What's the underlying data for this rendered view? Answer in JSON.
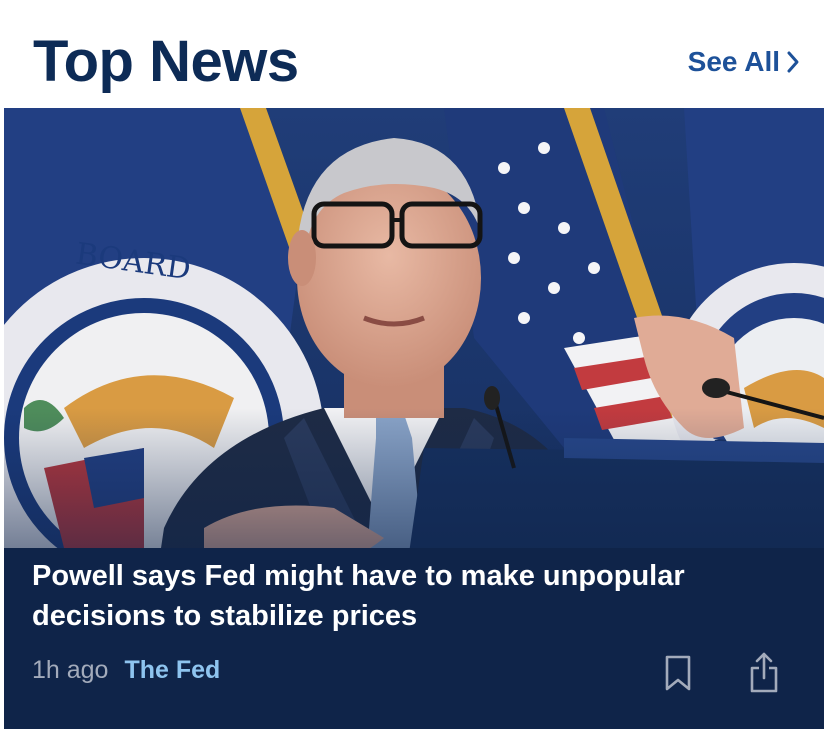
{
  "header": {
    "title": "Top News",
    "see_all_label": "See All",
    "see_all_icon": "chevron-right-icon"
  },
  "article": {
    "image_description": "Man in suit speaking at podium in front of flags",
    "headline": "Powell says Fed might have to make unpopular decisions to stabilize prices",
    "time": "1h ago",
    "tag": "The Fed",
    "actions": [
      {
        "icon": "bookmark-icon"
      },
      {
        "icon": "share-icon"
      }
    ]
  },
  "colors": {
    "title": "#0d2b56",
    "link": "#1d5199",
    "card_bg": "#0f2449",
    "tag": "#8ec4ef",
    "meta": "#a3abbb"
  }
}
